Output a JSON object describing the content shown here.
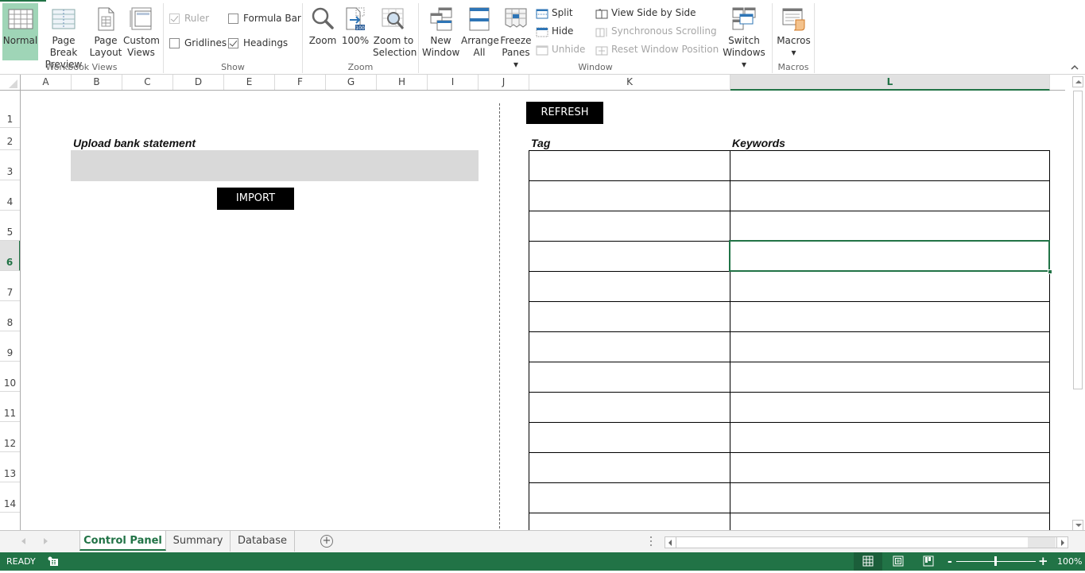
{
  "ribbon": {
    "groups": {
      "workbook_views": {
        "label": "Workbook Views",
        "buttons": [
          {
            "label": "Normal",
            "icon": "normal-view-icon",
            "active": true
          },
          {
            "label": "Page Break\nPreview",
            "icon": "page-break-preview-icon"
          },
          {
            "label": "Page\nLayout",
            "icon": "page-layout-icon"
          },
          {
            "label": "Custom\nViews",
            "icon": "custom-views-icon"
          }
        ]
      },
      "show": {
        "label": "Show",
        "ruler": {
          "label": "Ruler",
          "checked": true,
          "disabled": true
        },
        "formula_bar": {
          "label": "Formula Bar",
          "checked": false
        },
        "gridlines": {
          "label": "Gridlines",
          "checked": false
        },
        "headings": {
          "label": "Headings",
          "checked": true
        }
      },
      "zoom": {
        "label": "Zoom",
        "buttons": [
          {
            "label": "Zoom",
            "icon": "magnifier-icon"
          },
          {
            "label": "100%",
            "icon": "zoom-100-icon",
            "badge": "100"
          },
          {
            "label": "Zoom to\nSelection",
            "icon": "zoom-to-selection-icon"
          }
        ]
      },
      "window": {
        "label": "Window",
        "buttons": [
          {
            "label": "New\nWindow",
            "icon": "new-window-icon"
          },
          {
            "label": "Arrange\nAll",
            "icon": "arrange-all-icon"
          },
          {
            "label": "Freeze\nPanes ▾",
            "icon": "freeze-panes-icon"
          }
        ],
        "small": [
          {
            "label": "Split",
            "icon": "split-icon",
            "disabled": false
          },
          {
            "label": "Hide",
            "icon": "hide-icon",
            "disabled": false
          },
          {
            "label": "Unhide",
            "icon": "unhide-icon",
            "disabled": true
          },
          {
            "label": "View Side by Side",
            "icon": "view-side-by-side-icon",
            "disabled": false
          },
          {
            "label": "Synchronous Scrolling",
            "icon": "synchronous-scrolling-icon",
            "disabled": true
          },
          {
            "label": "Reset Window Position",
            "icon": "reset-window-position-icon",
            "disabled": true
          }
        ],
        "switch_windows": {
          "label": "Switch\nWindows ▾",
          "icon": "switch-windows-icon"
        }
      },
      "macros": {
        "label": "Macros",
        "button": {
          "label": "Macros\n▾",
          "icon": "macros-icon"
        }
      }
    }
  },
  "grid": {
    "columns": [
      "A",
      "B",
      "C",
      "D",
      "E",
      "F",
      "G",
      "H",
      "I",
      "J",
      "K",
      "L"
    ],
    "selected_column": "L",
    "rows": [
      "1",
      "2",
      "3",
      "4",
      "5",
      "6",
      "7",
      "8",
      "9",
      "10",
      "11",
      "12",
      "13",
      "14"
    ],
    "selected_row": "6"
  },
  "sheet_content": {
    "upload_label": "Upload bank statement",
    "upload_value": "",
    "import_button": "IMPORT",
    "refresh_button": "REFRESH",
    "table": {
      "headers": [
        "Tag",
        "Keywords"
      ],
      "rows": [
        [
          "",
          ""
        ],
        [
          "",
          ""
        ],
        [
          "",
          ""
        ],
        [
          "",
          ""
        ],
        [
          "",
          ""
        ],
        [
          "",
          ""
        ],
        [
          "",
          ""
        ],
        [
          "",
          ""
        ],
        [
          "",
          ""
        ],
        [
          "",
          ""
        ],
        [
          "",
          ""
        ],
        [
          "",
          ""
        ],
        [
          "",
          ""
        ]
      ]
    }
  },
  "sheet_tabs": [
    {
      "label": "Control Panel",
      "active": true
    },
    {
      "label": "Summary",
      "active": false
    },
    {
      "label": "Database",
      "active": false
    }
  ],
  "add_sheet_symbol": "+",
  "status": {
    "mode": "READY",
    "zoom_level": "100%",
    "zoom_minus": "-",
    "zoom_plus": "+",
    "zoom_percent": 100
  },
  "colors": {
    "accent": "#217346",
    "active_view_bg": "#9fd5b7",
    "upload_box": "#d9d9d9"
  }
}
